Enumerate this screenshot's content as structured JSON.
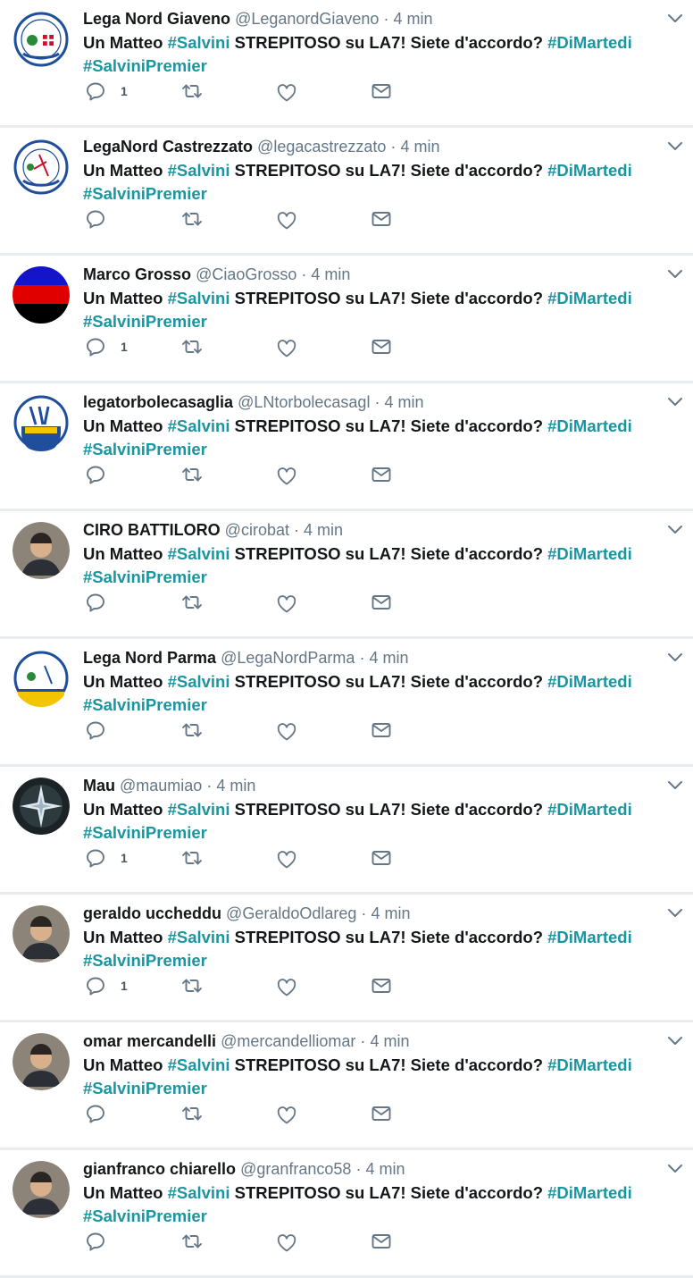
{
  "tweet_text": {
    "prefix": "Un Matteo ",
    "tag1": "#Salvini",
    "middle": " STREPITOSO su LA7! Siete d'accordo? ",
    "tag2": "#DiMartedi",
    "tag3": "#SalviniPremier"
  },
  "colors": {
    "accent": "#1b95a0",
    "text": "#14171a",
    "muted": "#657786",
    "divider": "#e6ecf0"
  },
  "icons": {
    "reply": "reply-icon",
    "retweet": "retweet-icon",
    "like": "heart-icon",
    "dm": "envelope-icon",
    "menu": "chevron-down-icon"
  },
  "tweets": [
    {
      "name": "Lega Nord Giaveno",
      "handle": "@LeganordGiaveno",
      "separator": "·",
      "time": "4 min",
      "reply_count": "1",
      "avatar": "lega-nord-valsangone-logo"
    },
    {
      "name": "LegaNord Castrezzato",
      "handle": "@legacastrezzato",
      "separator": "·",
      "time": "4 min",
      "reply_count": "",
      "avatar": "lega-nord-padania-logo"
    },
    {
      "name": "Marco Grosso",
      "handle": "@CiaoGrosso",
      "separator": "·",
      "time": "4 min",
      "reply_count": "1",
      "avatar": "blue-red-black-flag"
    },
    {
      "name": "legatorbolecasaglia",
      "handle": "@LNtorbolecasagl",
      "separator": "·",
      "time": "4 min",
      "reply_count": "",
      "avatar": "lega-salvini-premier-logo"
    },
    {
      "name": "CIRO BATTILORO",
      "handle": "@cirobat",
      "separator": "·",
      "time": "4 min",
      "reply_count": "",
      "avatar": "user-photo"
    },
    {
      "name": "Lega Nord Parma",
      "handle": "@LegaNordParma",
      "separator": "·",
      "time": "4 min",
      "reply_count": "",
      "avatar": "lega-nord-parma-logo"
    },
    {
      "name": "Mau",
      "handle": "@maumiao",
      "separator": "·",
      "time": "4 min",
      "reply_count": "1",
      "avatar": "star-photo"
    },
    {
      "name": "geraldo uccheddu",
      "handle": "@GeraldoOdlareg",
      "separator": "·",
      "time": "4 min",
      "reply_count": "1",
      "avatar": "user-photo"
    },
    {
      "name": "omar mercandelli",
      "handle": "@mercandelliomar",
      "separator": "·",
      "time": "4 min",
      "reply_count": "",
      "avatar": "user-photo"
    },
    {
      "name": "gianfranco chiarello",
      "handle": "@granfranco58",
      "separator": "·",
      "time": "4 min",
      "reply_count": "",
      "avatar": "user-photo"
    }
  ]
}
